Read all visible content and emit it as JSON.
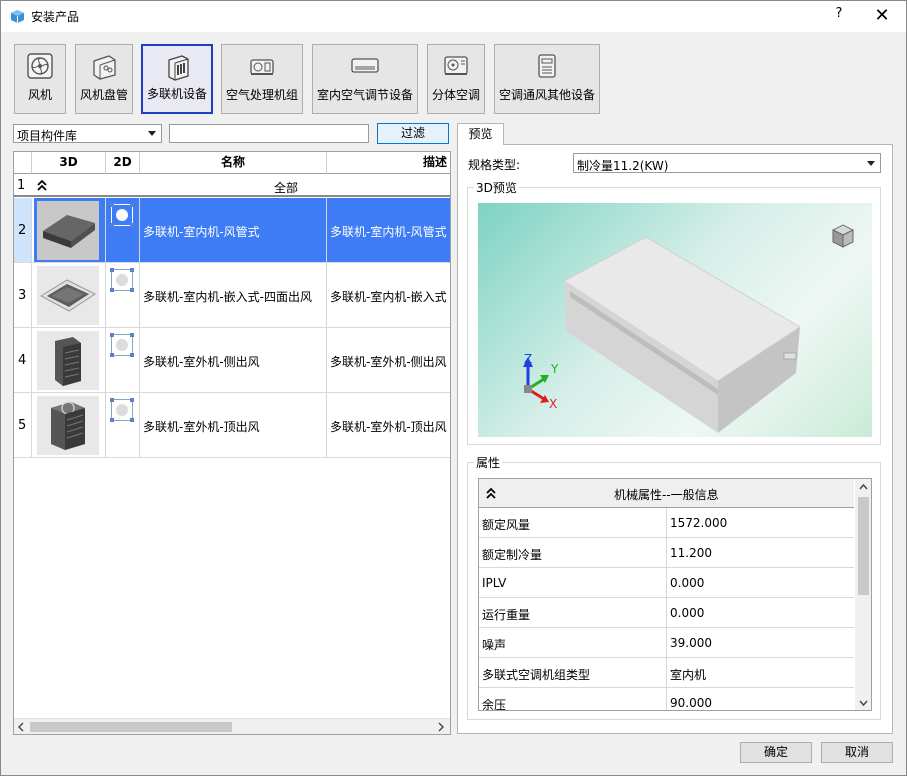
{
  "window": {
    "title": "安装产品",
    "help": "?",
    "close": "✕"
  },
  "toolbar": [
    {
      "label": "风机",
      "icon": "fan-icon"
    },
    {
      "label": "风机盘管",
      "icon": "fan-coil-icon"
    },
    {
      "label": "多联机设备",
      "icon": "vrf-unit-icon"
    },
    {
      "label": "空气处理机组",
      "icon": "air-handling-unit-icon"
    },
    {
      "label": "室内空气调节设备",
      "icon": "indoor-ac-icon"
    },
    {
      "label": "分体空调",
      "icon": "split-ac-icon"
    },
    {
      "label": "空调通风其他设备",
      "icon": "hvac-other-icon"
    }
  ],
  "filter": {
    "library": "项目构件库",
    "search_value": "",
    "filter_button": "过滤"
  },
  "grid": {
    "columns": [
      "3D",
      "2D",
      "名称",
      "描述"
    ],
    "group": {
      "row": "1",
      "label": "全部"
    },
    "rows": [
      {
        "num": "2",
        "name": "多联机-室内机-风管式",
        "desc": "多联机-室内机-风管式",
        "selected": true,
        "thumb": "duct-unit"
      },
      {
        "num": "3",
        "name": "多联机-室内机-嵌入式-四面出风",
        "desc": "多联机-室内机-嵌入式",
        "selected": false,
        "thumb": "cassette"
      },
      {
        "num": "4",
        "name": "多联机-室外机-侧出风",
        "desc": "多联机-室外机-侧出风",
        "selected": false,
        "thumb": "side-outdoor"
      },
      {
        "num": "5",
        "name": "多联机-室外机-顶出风",
        "desc": "多联机-室外机-顶出风",
        "selected": false,
        "thumb": "top-outdoor"
      }
    ]
  },
  "preview": {
    "tab": "预览",
    "spec_label": "规格类型:",
    "spec_value": "制冷量11.2(KW)",
    "view3d_title": "3D预览",
    "axes": {
      "z": "Z",
      "y": "Y",
      "x": "X"
    }
  },
  "properties": {
    "title": "属性",
    "header": "机械属性--一般信息",
    "rows": [
      {
        "key": "额定风量",
        "value": "1572.000"
      },
      {
        "key": "额定制冷量",
        "value": "11.200"
      },
      {
        "key": "IPLV",
        "value": "0.000"
      },
      {
        "key": "运行重量",
        "value": "0.000"
      },
      {
        "key": "噪声",
        "value": "39.000"
      },
      {
        "key": "多联式空调机组类型",
        "value": "室内机"
      },
      {
        "key": "余压",
        "value": "90.000"
      }
    ]
  },
  "footer": {
    "ok": "确定",
    "cancel": "取消"
  }
}
